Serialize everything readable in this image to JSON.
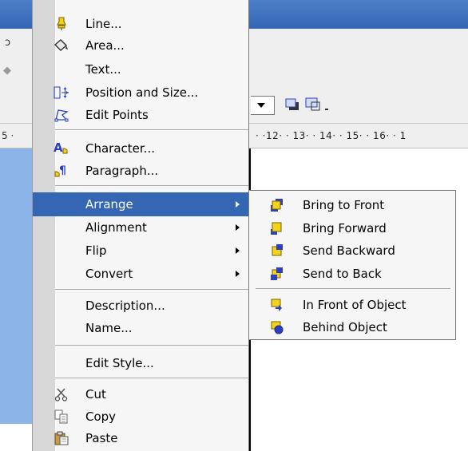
{
  "background": {
    "menubar_fragment": "ɔ",
    "toolbar_fragment": "◆",
    "ruler_left": "5 ·",
    "ruler_right": "· ·12· · 13· · 14· · 15· · 16· · 1"
  },
  "context_menu": {
    "items": [
      {
        "label": "Line...",
        "icon": "line-icon"
      },
      {
        "label": "Area...",
        "icon": "area-fill-icon"
      },
      {
        "label": "Text...",
        "icon": ""
      },
      {
        "label": "Position and Size...",
        "icon": "position-size-icon"
      },
      {
        "label": "Edit Points",
        "icon": "edit-points-icon"
      },
      {
        "label": "Character...",
        "icon": "character-icon"
      },
      {
        "label": "Paragraph...",
        "icon": "paragraph-icon"
      },
      {
        "label": "Arrange",
        "submenu": true,
        "highlighted": true
      },
      {
        "label": "Alignment",
        "submenu": true
      },
      {
        "label": "Flip",
        "submenu": true
      },
      {
        "label": "Convert",
        "submenu": true
      },
      {
        "label": "Description..."
      },
      {
        "label": "Name..."
      },
      {
        "label": "Edit Style..."
      },
      {
        "label": "Cut",
        "icon": "scissors-icon"
      },
      {
        "label": "Copy",
        "icon": "copy-icon"
      },
      {
        "label": "Paste",
        "icon": "paste-icon"
      }
    ]
  },
  "arrange_submenu": {
    "items": [
      {
        "label": "Bring to Front",
        "icon": "bring-to-front-icon"
      },
      {
        "label": "Bring Forward",
        "icon": "bring-forward-icon"
      },
      {
        "label": "Send Backward",
        "icon": "send-backward-icon"
      },
      {
        "label": "Send to Back",
        "icon": "send-to-back-icon"
      },
      {
        "label": "In Front of Object",
        "icon": "in-front-of-object-icon"
      },
      {
        "label": "Behind Object",
        "icon": "behind-object-icon"
      }
    ]
  },
  "colors": {
    "highlight": "#3466b4",
    "icon_yellow": "#f2d21c",
    "icon_blue": "#2b3fc4"
  }
}
